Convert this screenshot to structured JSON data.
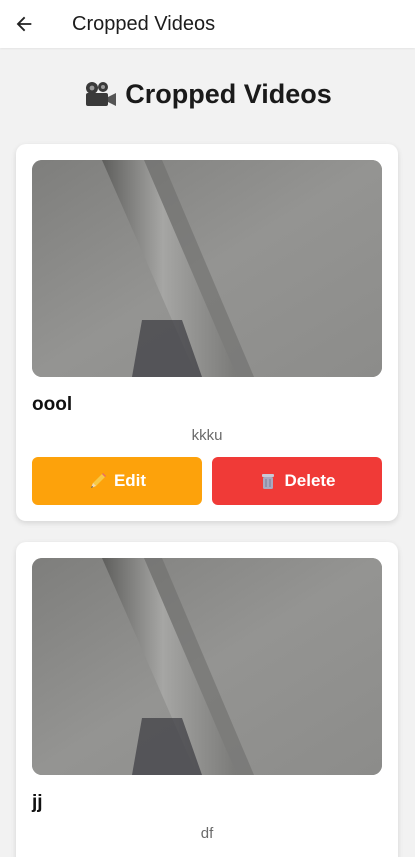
{
  "appbar": {
    "title": "Cropped Videos",
    "back_icon": "arrow-left-icon"
  },
  "page": {
    "heading": "Cropped Videos",
    "heading_icon": "movie-camera-icon"
  },
  "colors": {
    "edit_button": "#fda20b",
    "delete_button": "#f03a37",
    "background": "#f2f2f2"
  },
  "videos": [
    {
      "title": "oool",
      "description": "kkku",
      "edit_label": "Edit",
      "edit_icon": "pencil-icon",
      "delete_label": "Delete",
      "delete_icon": "trash-icon"
    },
    {
      "title": "jj",
      "description": "df"
    }
  ]
}
